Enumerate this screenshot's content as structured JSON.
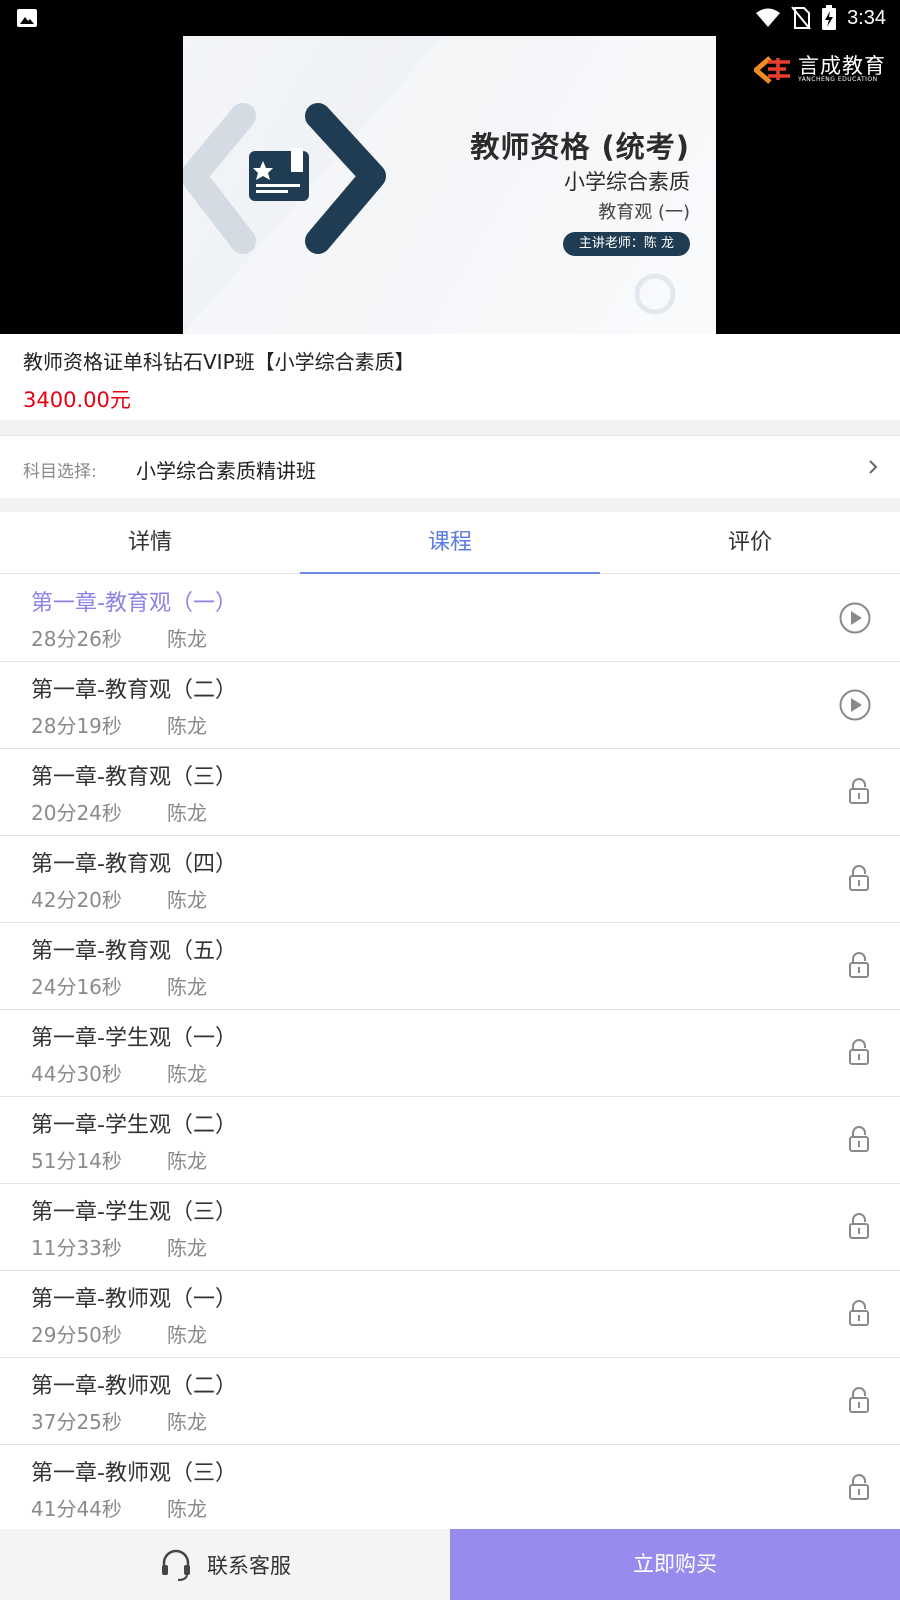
{
  "status_bar": {
    "time": "3:34",
    "icons": [
      "image-icon",
      "wifi-icon",
      "no-sim-icon",
      "battery-charging-icon"
    ]
  },
  "banner": {
    "title": "教师资格 (统考)",
    "subtitle": "小学综合素质",
    "topic": "教育观 (一)",
    "lecturer": "主讲老师：陈 龙",
    "brand_name": "言成教育",
    "brand_en": "YANCHENG EDUCATION",
    "colors": {
      "accent": "#1f3c52",
      "brand_orange": "#f08a24"
    }
  },
  "product": {
    "title": "教师资格证单科钻石VIP班【小学综合素质】",
    "price": "3400.00元",
    "price_color": "#e60012"
  },
  "subject": {
    "label": "科目选择:",
    "value": "小学综合素质精讲班"
  },
  "tabs": [
    {
      "label": "详情",
      "active": false
    },
    {
      "label": "课程",
      "active": true
    },
    {
      "label": "评价",
      "active": false
    }
  ],
  "lessons": [
    {
      "title": "第一章-教育观（一）",
      "duration": "28分26秒",
      "teacher": "陈龙",
      "icon": "play-icon",
      "active": true
    },
    {
      "title": "第一章-教育观（二）",
      "duration": "28分19秒",
      "teacher": "陈龙",
      "icon": "play-icon",
      "active": false
    },
    {
      "title": "第一章-教育观（三）",
      "duration": "20分24秒",
      "teacher": "陈龙",
      "icon": "lock-icon",
      "active": false
    },
    {
      "title": "第一章-教育观（四）",
      "duration": "42分20秒",
      "teacher": "陈龙",
      "icon": "lock-icon",
      "active": false
    },
    {
      "title": "第一章-教育观（五）",
      "duration": "24分16秒",
      "teacher": "陈龙",
      "icon": "lock-icon",
      "active": false
    },
    {
      "title": "第一章-学生观（一）",
      "duration": "44分30秒",
      "teacher": "陈龙",
      "icon": "lock-icon",
      "active": false
    },
    {
      "title": "第一章-学生观（二）",
      "duration": "51分14秒",
      "teacher": "陈龙",
      "icon": "lock-icon",
      "active": false
    },
    {
      "title": "第一章-学生观（三）",
      "duration": "11分33秒",
      "teacher": "陈龙",
      "icon": "lock-icon",
      "active": false
    },
    {
      "title": "第一章-教师观（一）",
      "duration": "29分50秒",
      "teacher": "陈龙",
      "icon": "lock-icon",
      "active": false
    },
    {
      "title": "第一章-教师观（二）",
      "duration": "37分25秒",
      "teacher": "陈龙",
      "icon": "lock-icon",
      "active": false
    },
    {
      "title": "第一章-教师观（三）",
      "duration": "41分44秒",
      "teacher": "陈龙",
      "icon": "lock-icon",
      "active": false
    }
  ],
  "bottom_bar": {
    "contact_label": "联系客服",
    "buy_label": "立即购买",
    "buy_color": "#978ced"
  }
}
